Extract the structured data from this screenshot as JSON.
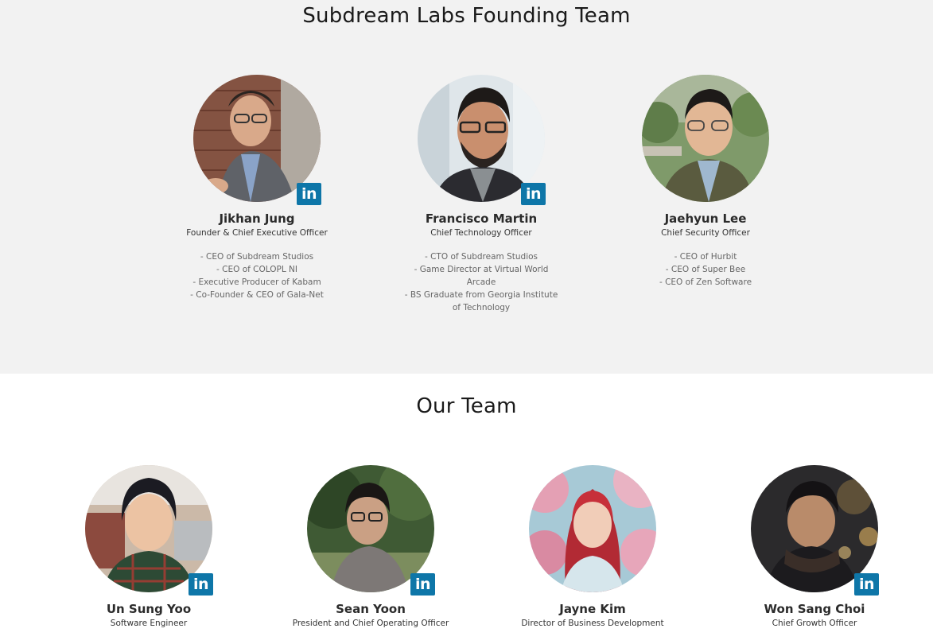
{
  "founding_section": {
    "title": "Subdream Labs Founding Team",
    "members": [
      {
        "name": "Jikhan Jung",
        "role": "Founder & Chief Executive Officer",
        "bio": [
          "- CEO of Subdream Studios",
          "- CEO of COLOPL NI",
          "- Executive Producer of Kabam",
          "- Co-Founder & CEO of Gala-Net"
        ],
        "linkedin_label": "in"
      },
      {
        "name": "Francisco Martin",
        "role": "Chief Technology Officer",
        "bio": [
          "- CTO of Subdream Studios",
          "- Game Director at Virtual World Arcade",
          "- BS Graduate from Georgia Institute of Technology"
        ],
        "linkedin_label": "in"
      },
      {
        "name": "Jaehyun Lee",
        "role": "Chief Security Officer",
        "bio": [
          "- CEO of Hurbit",
          "- CEO of Super Bee",
          "- CEO of Zen Software"
        ],
        "linkedin_label": "in"
      }
    ]
  },
  "team_section": {
    "title": "Our Team",
    "members": [
      {
        "name": "Un Sung Yoo",
        "role": "Software Engineer",
        "linkedin_label": "in"
      },
      {
        "name": "Sean Yoon",
        "role": "President and Chief Operating Officer",
        "linkedin_label": "in"
      },
      {
        "name": "Jayne Kim",
        "role": "Director of Business Development",
        "linkedin_label": "in"
      },
      {
        "name": "Won Sang Choi",
        "role": "Chief Growth Officer",
        "linkedin_label": "in"
      }
    ]
  },
  "colors": {
    "founders_background": "#f2f2f2",
    "linkedin_blue": "#0e76a8"
  }
}
